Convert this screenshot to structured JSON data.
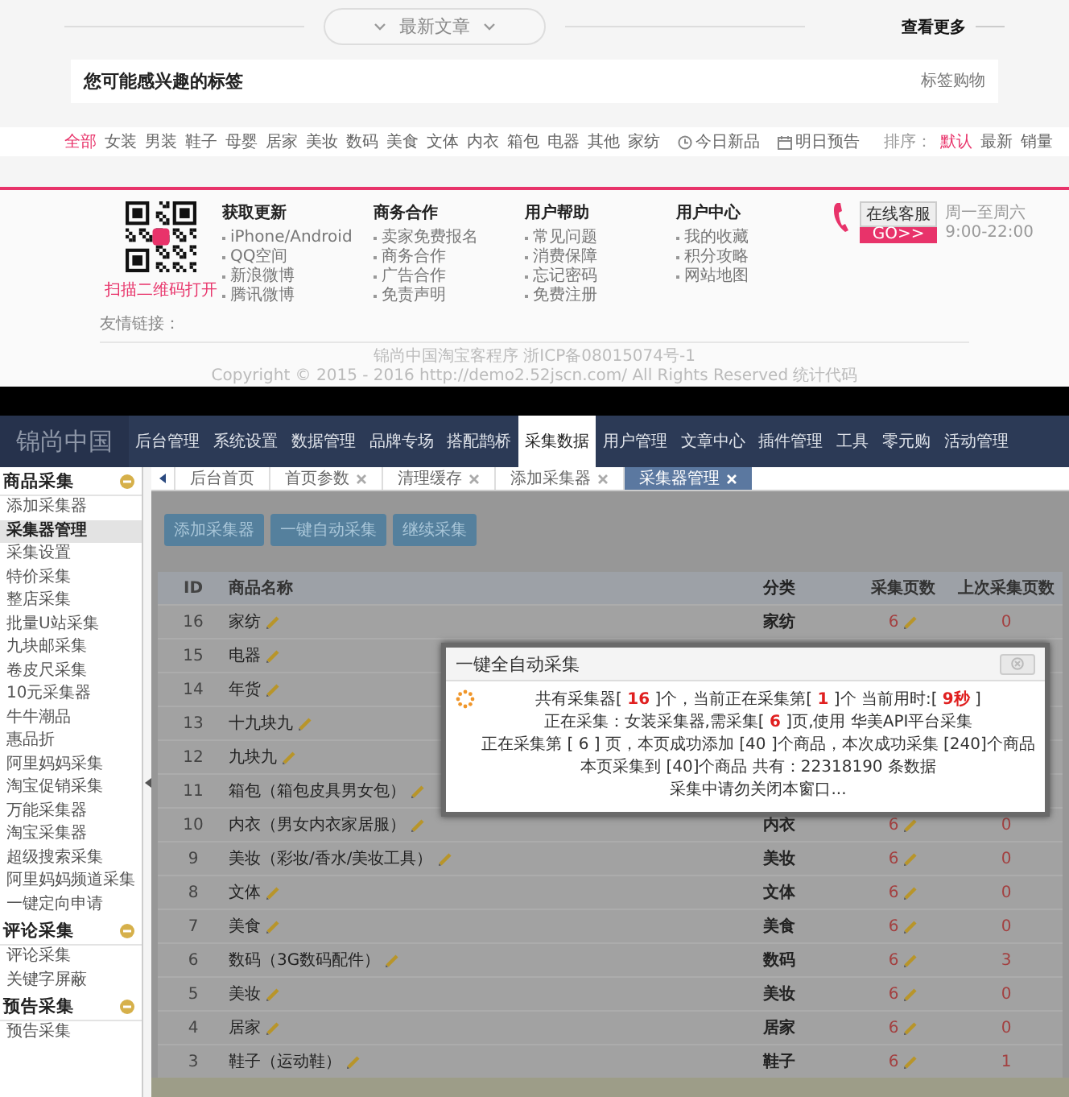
{
  "latest_header": {
    "title": "最新文章",
    "more": "查看更多"
  },
  "tag_box": {
    "title": "您可能感兴趣的标签",
    "link": "标签购物"
  },
  "category_bar": {
    "categories": [
      {
        "label": "全部",
        "selected": true
      },
      {
        "label": "女装",
        "selected": false
      },
      {
        "label": "男装",
        "selected": false
      },
      {
        "label": "鞋子",
        "selected": false
      },
      {
        "label": "母婴",
        "selected": false
      },
      {
        "label": "居家",
        "selected": false
      },
      {
        "label": "美妆",
        "selected": false
      },
      {
        "label": "数码",
        "selected": false
      },
      {
        "label": "美食",
        "selected": false
      },
      {
        "label": "文体",
        "selected": false
      },
      {
        "label": "内衣",
        "selected": false
      },
      {
        "label": "箱包",
        "selected": false
      },
      {
        "label": "电器",
        "selected": false
      },
      {
        "label": "其他",
        "selected": false
      },
      {
        "label": "家纺",
        "selected": false
      }
    ],
    "specials": [
      {
        "label": "今日新品",
        "kind": "clock"
      },
      {
        "label": "明日预告",
        "kind": "calendar"
      }
    ],
    "sort_label": "排序：",
    "sort_options": [
      {
        "label": "默认",
        "selected": true
      },
      {
        "label": "最新",
        "selected": false
      },
      {
        "label": "销量",
        "selected": false
      }
    ]
  },
  "footer": {
    "qr_caption": "扫描二维码打开",
    "columns": [
      {
        "title": "获取更新",
        "links": [
          "iPhone/Android",
          "QQ空间",
          "新浪微博",
          "腾讯微博"
        ]
      },
      {
        "title": "商务合作",
        "links": [
          "卖家免费报名",
          "商务合作",
          "广告合作",
          "免责声明"
        ]
      },
      {
        "title": "用户帮助",
        "links": [
          "常见问题",
          "消费保障",
          "忘记密码",
          "免费注册"
        ]
      },
      {
        "title": "用户中心",
        "links": [
          "我的收藏",
          "积分攻略",
          "网站地图"
        ]
      }
    ],
    "service": {
      "button": "在线客服",
      "go": "GO>>",
      "days": "周一至周六",
      "time": "9:00-22:00"
    },
    "friend_links": "友情链接：",
    "copyright": [
      "锦尚中国淘宝客程序 浙ICP备08015074号-1",
      "Copyright © 2015 - 2016 http://demo2.52jscn.com/ All Rights Reserved 统计代码"
    ]
  },
  "nav": {
    "logo": "锦尚中国",
    "items": [
      {
        "label": "后台管理",
        "selected": false
      },
      {
        "label": "系统设置",
        "selected": false
      },
      {
        "label": "数据管理",
        "selected": false
      },
      {
        "label": "品牌专场",
        "selected": false
      },
      {
        "label": "搭配鹊桥",
        "selected": false
      },
      {
        "label": "采集数据",
        "selected": true
      },
      {
        "label": "用户管理",
        "selected": false
      },
      {
        "label": "文章中心",
        "selected": false
      },
      {
        "label": "插件管理",
        "selected": false
      },
      {
        "label": "工具",
        "selected": false
      },
      {
        "label": "零元购",
        "selected": false
      },
      {
        "label": "活动管理",
        "selected": false
      }
    ]
  },
  "tabs": [
    {
      "label": "后台首页",
      "closable": false,
      "selected": false
    },
    {
      "label": "首页参数",
      "closable": true,
      "selected": false
    },
    {
      "label": "清理缓存",
      "closable": true,
      "selected": false
    },
    {
      "label": "添加采集器",
      "closable": true,
      "selected": false
    },
    {
      "label": "采集器管理",
      "closable": true,
      "selected": true
    }
  ],
  "sidebar": {
    "groups": [
      {
        "title": "商品采集",
        "expanded": true,
        "items": [
          {
            "label": "添加采集器",
            "selected": false
          },
          {
            "label": "采集器管理",
            "selected": true
          },
          {
            "label": "采集设置",
            "selected": false
          },
          {
            "label": "特价采集",
            "selected": false
          },
          {
            "label": "整店采集",
            "selected": false
          },
          {
            "label": "批量U站采集",
            "selected": false
          },
          {
            "label": "九块邮采集",
            "selected": false
          },
          {
            "label": "卷皮尺采集",
            "selected": false
          },
          {
            "label": "10元采集器",
            "selected": false
          },
          {
            "label": "牛牛潮品",
            "selected": false
          },
          {
            "label": "惠品折",
            "selected": false
          },
          {
            "label": "阿里妈妈采集",
            "selected": false
          },
          {
            "label": "淘宝促销采集",
            "selected": false
          },
          {
            "label": "万能采集器",
            "selected": false
          },
          {
            "label": "淘宝采集器",
            "selected": false
          },
          {
            "label": "超级搜索采集",
            "selected": false
          },
          {
            "label": "阿里妈妈频道采集",
            "selected": false
          },
          {
            "label": "一键定向申请",
            "selected": false
          }
        ]
      },
      {
        "title": "评论采集",
        "expanded": true,
        "items": [
          {
            "label": "评论采集",
            "selected": false
          },
          {
            "label": "关键字屏蔽",
            "selected": false
          }
        ]
      },
      {
        "title": "预告采集",
        "expanded": true,
        "items": [
          {
            "label": "预告采集",
            "selected": false
          }
        ]
      }
    ]
  },
  "toolbar": [
    "添加采集器",
    "一键自动采集",
    "继续采集"
  ],
  "table": {
    "columns": [
      "ID",
      "商品名称",
      "分类",
      "采集页数",
      "上次采集页数"
    ],
    "rows": [
      {
        "id": "16",
        "name": "家纺",
        "category": "家纺",
        "pages": "6",
        "last": "0"
      },
      {
        "id": "15",
        "name": "电器"
      },
      {
        "id": "14",
        "name": "年货"
      },
      {
        "id": "13",
        "name": "十九块九"
      },
      {
        "id": "12",
        "name": "九块九"
      },
      {
        "id": "11",
        "name": "箱包（箱包皮具男女包）"
      },
      {
        "id": "10",
        "name": "内衣（男女内衣家居服）",
        "category": "内衣",
        "pages": "6",
        "last": "0"
      },
      {
        "id": "9",
        "name": "美妆（彩妆/香水/美妆工具）",
        "category": "美妆",
        "pages": "6",
        "last": "0"
      },
      {
        "id": "8",
        "name": "文体",
        "category": "文体",
        "pages": "6",
        "last": "0"
      },
      {
        "id": "7",
        "name": "美食",
        "category": "美食",
        "pages": "6",
        "last": "0"
      },
      {
        "id": "6",
        "name": "数码（3G数码配件）",
        "category": "数码",
        "pages": "6",
        "last": "3"
      },
      {
        "id": "5",
        "name": "美妆",
        "category": "美妆",
        "pages": "6",
        "last": "0"
      },
      {
        "id": "4",
        "name": "居家",
        "category": "居家",
        "pages": "6",
        "last": "0"
      },
      {
        "id": "3",
        "name": "鞋子（运动鞋）",
        "category": "鞋子",
        "pages": "6",
        "last": "1"
      }
    ]
  },
  "dialog": {
    "title": "一键全自动采集",
    "lines": [
      "共有采集器[ **16** ]个，当前正在采集第[ **1** ]个 当前用时:[ **9秒** ]",
      "正在采集：女装采集器,需采集[ **6** ]页,使用 华美API平台采集",
      "正在采集第 [ 6 ] 页，本页成功添加 [40 ]个商品，本次成功采集 [240]个商品",
      "本页采集到 [40]个商品 共有：22318190 条数据",
      "采集中请勿关闭本窗口..."
    ]
  }
}
